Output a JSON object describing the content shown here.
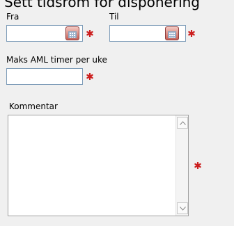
{
  "form": {
    "heading": "Sett tidsrom for disponering",
    "from_label": "Fra",
    "to_label": "Til",
    "max_hours_label": "Maks AML timer per uke",
    "comment_label": "Kommentar",
    "from_value": "",
    "to_value": "",
    "max_hours_value": "",
    "comment_value": ""
  },
  "icons": {
    "calendar": "calendar-icon",
    "required": "required-asterisk-icon",
    "scroll_up": "scroll-up-icon",
    "scroll_down": "scroll-down-icon"
  },
  "colors": {
    "required": "#cc1f1f",
    "input_border": "#7f9db9",
    "background": "#f0f0f0"
  }
}
